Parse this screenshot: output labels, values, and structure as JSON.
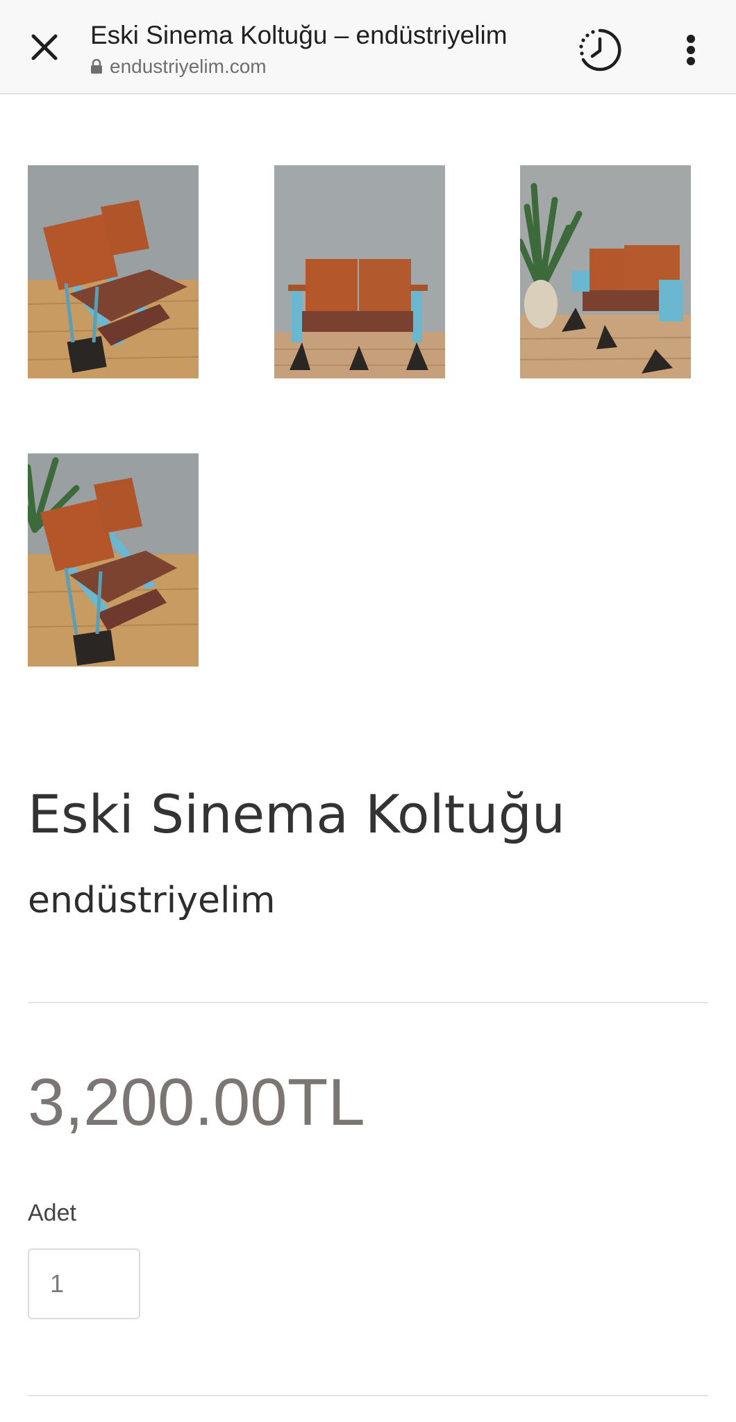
{
  "browser": {
    "page_title": "Eski Sinema Koltuğu – endüstriyelim",
    "url": "endustriyelim.com",
    "icons": {
      "close": "close-icon",
      "lock": "lock-icon",
      "history": "history-icon",
      "menu": "more-vert-icon"
    }
  },
  "gallery": {
    "image_count": 4,
    "colors": {
      "wall": "#9aa0a3",
      "floor": "#c49a63",
      "seat_wood": "#b4562a",
      "seat_leather": "#7a4030",
      "frame_blue": "#6ab7cf",
      "base": "#2a2624"
    }
  },
  "product": {
    "title": "Eski Sinema Koltuğu",
    "vendor": "endüstriyelim",
    "price": "3,200.00TL",
    "quantity_label": "Adet",
    "quantity_value": "1"
  }
}
